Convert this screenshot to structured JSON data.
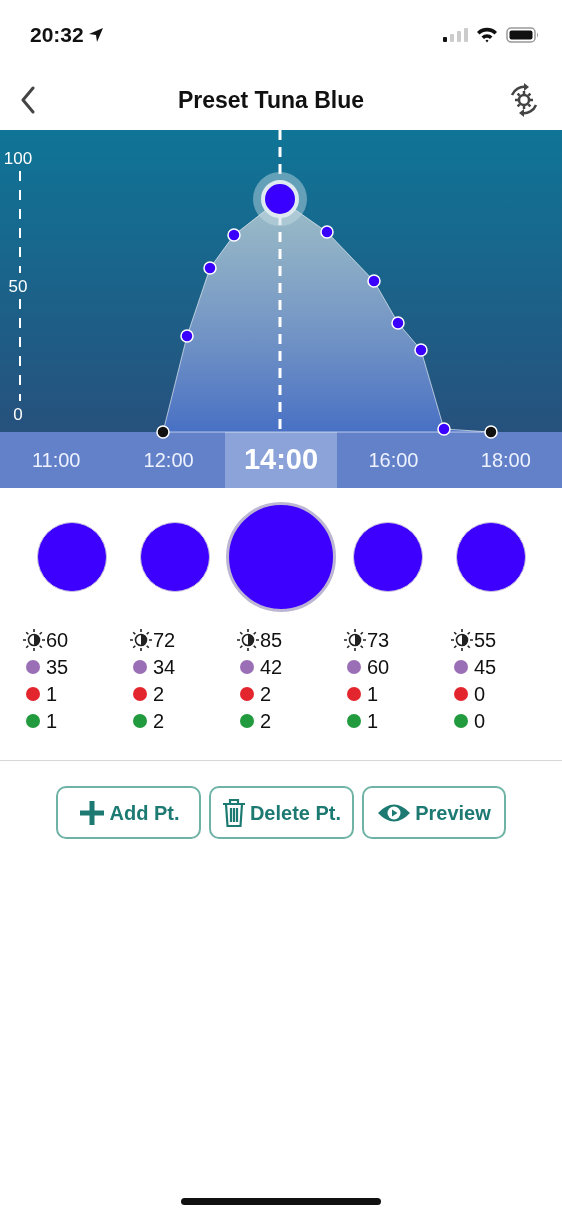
{
  "status_bar": {
    "time": "20:32"
  },
  "nav": {
    "title": "Preset Tuna Blue"
  },
  "chart": {
    "y_axis_labels": [
      "100",
      "50",
      "0"
    ],
    "markers": [
      {
        "color": "#111111",
        "selected": false
      },
      {
        "color": "#3a00ff",
        "selected": false
      },
      {
        "color": "#3a00ff",
        "selected": false
      },
      {
        "color": "#3a00ff",
        "selected": false
      },
      {
        "color": "#3a00ff",
        "selected": true
      },
      {
        "color": "#3a00ff",
        "selected": false
      },
      {
        "color": "#3a00ff",
        "selected": false
      },
      {
        "color": "#3a00ff",
        "selected": false
      },
      {
        "color": "#3a00ff",
        "selected": false
      },
      {
        "color": "#3a00ff",
        "selected": false
      },
      {
        "color": "#111111",
        "selected": false
      }
    ]
  },
  "time_tabs": [
    {
      "label": "11:00",
      "selected": false
    },
    {
      "label": "12:00",
      "selected": false
    },
    {
      "label": "14:00",
      "selected": true
    },
    {
      "label": "16:00",
      "selected": false
    },
    {
      "label": "18:00",
      "selected": false
    }
  ],
  "columns": [
    {
      "color": "#3d00ff",
      "selected": false,
      "brightness": "60",
      "channels": [
        {
          "color": "#9b6fb5",
          "value": "35"
        },
        {
          "color": "#e3262e",
          "value": "1"
        },
        {
          "color": "#229a3e",
          "value": "1"
        }
      ]
    },
    {
      "color": "#3d00ff",
      "selected": false,
      "brightness": "72",
      "channels": [
        {
          "color": "#9b6fb5",
          "value": "34"
        },
        {
          "color": "#e3262e",
          "value": "2"
        },
        {
          "color": "#229a3e",
          "value": "2"
        }
      ]
    },
    {
      "color": "#3d00ff",
      "selected": true,
      "brightness": "85",
      "channels": [
        {
          "color": "#9b6fb5",
          "value": "42"
        },
        {
          "color": "#e3262e",
          "value": "2"
        },
        {
          "color": "#229a3e",
          "value": "2"
        }
      ]
    },
    {
      "color": "#3d00ff",
      "selected": false,
      "brightness": "73",
      "channels": [
        {
          "color": "#9b6fb5",
          "value": "60"
        },
        {
          "color": "#e3262e",
          "value": "1"
        },
        {
          "color": "#229a3e",
          "value": "1"
        }
      ]
    },
    {
      "color": "#3d00ff",
      "selected": false,
      "brightness": "55",
      "channels": [
        {
          "color": "#9b6fb5",
          "value": "45"
        },
        {
          "color": "#e3262e",
          "value": "0"
        },
        {
          "color": "#229a3e",
          "value": "0"
        }
      ]
    }
  ],
  "buttons": [
    {
      "kind": "add",
      "label": "Add Pt."
    },
    {
      "kind": "delete",
      "label": "Delete Pt."
    },
    {
      "kind": "preview",
      "label": "Preview"
    }
  ]
}
